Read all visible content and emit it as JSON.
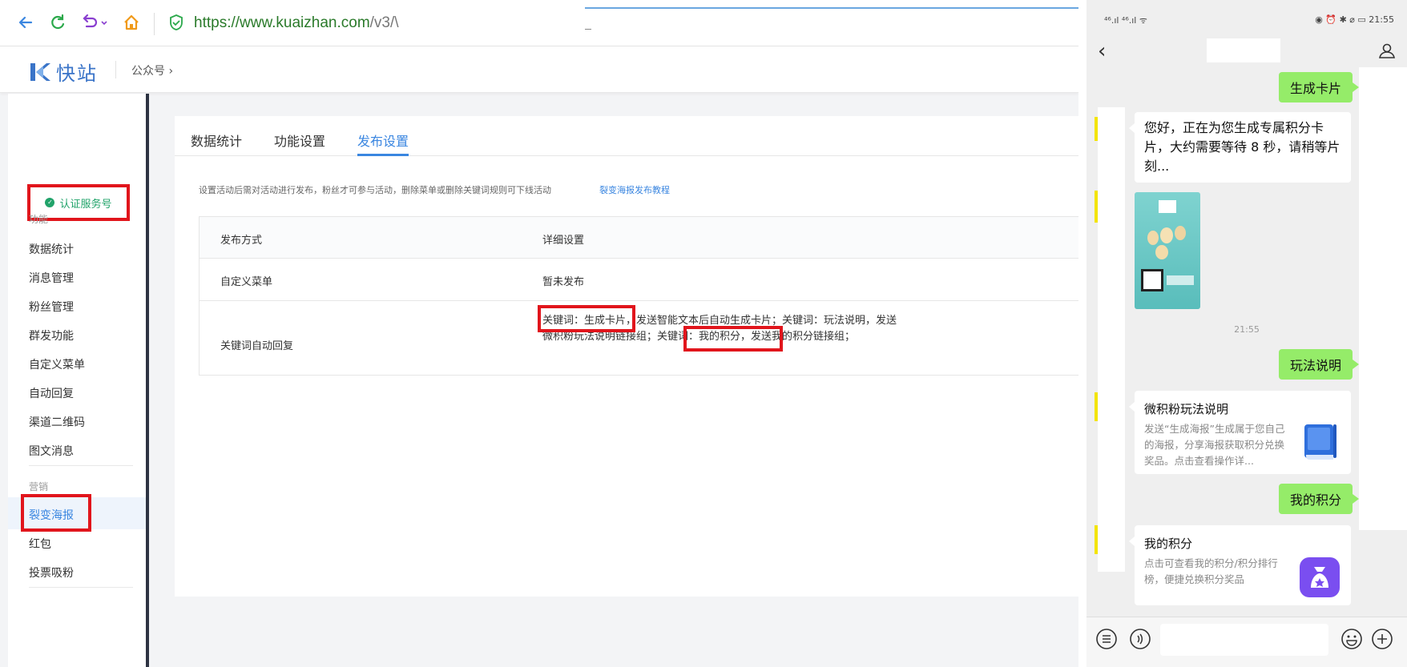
{
  "browser": {
    "url_host": "https://www.kuaizhan.com",
    "url_path": "/v3/\\"
  },
  "app": {
    "brand": "快站",
    "breadcrumb": "公众号 ›"
  },
  "sidebar": {
    "verify_label": "认证服务号",
    "section_function": "功能",
    "items_function": [
      "数据统计",
      "消息管理",
      "粉丝管理",
      "群发功能",
      "自定义菜单",
      "自动回复",
      "渠道二维码",
      "图文消息"
    ],
    "section_marketing": "营销",
    "items_marketing": [
      "裂变海报",
      "红包",
      "投票吸粉"
    ]
  },
  "main": {
    "tabs": [
      "数据统计",
      "功能设置",
      "发布设置"
    ],
    "active_tab": "发布设置",
    "hint": "设置活动后需对活动进行发布，粉丝才可参与活动，删除菜单或删除关键词规则可下线活动",
    "hint_link": "裂变海报发布教程",
    "table": {
      "col1": "发布方式",
      "col2": "详细设置",
      "rows": [
        {
          "method": "自定义菜单",
          "detail": "暂未发布"
        },
        {
          "method": "关键词自动回复",
          "detail": "关键词：生成卡片，发送智能文本后自动生成卡片；关键词：玩法说明，发送微积粉玩法说明链接组；关键词：我的积分，发送我的积分链接组；"
        }
      ]
    }
  },
  "phone": {
    "status_left": "⁴⁶.ıl ⁴⁶.ıl ᯤ",
    "status_right": "◉ ⏰ ✱ ⌀ ▭ 21:55",
    "messages": {
      "m1": "生成卡片",
      "m2": "您好，正在为您生成专属积分卡片，大约需要等待 8 秒，请稍等片刻...",
      "time": "21:55",
      "m3": "玩法说明",
      "card1_title": "微积粉玩法说明",
      "card1_desc": "发送“生成海报”生成属于您自己的海报，分享海报获取积分兑换奖品。点击查看操作详...",
      "m4": "我的积分",
      "card2_title": "我的积分",
      "card2_desc": "点击可查看我的积分/积分排行榜，便捷兑换积分奖品"
    }
  },
  "colors": {
    "accent": "#3a86e0",
    "highlight": "#e1151c",
    "verified": "#21a36a",
    "wechat_green": "#95ec69"
  }
}
